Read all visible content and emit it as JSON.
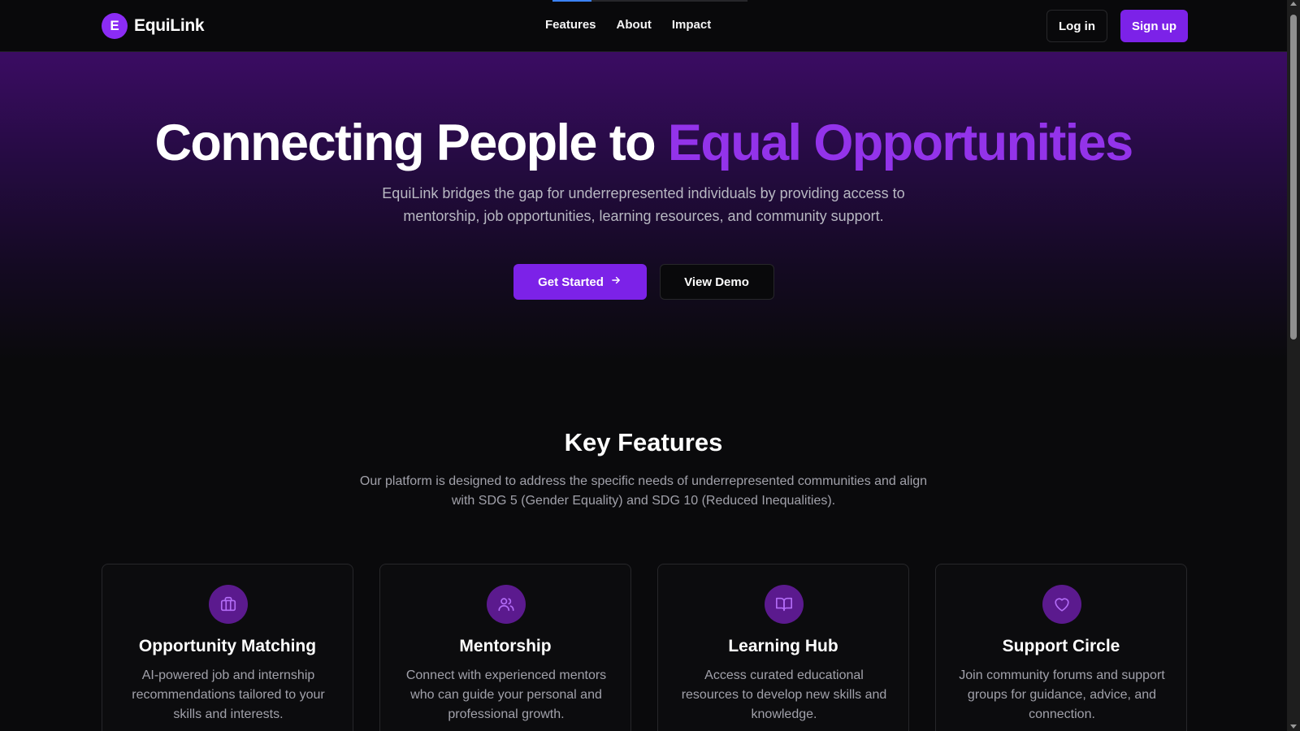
{
  "brand": {
    "mark": "E",
    "name": "EquiLink"
  },
  "nav": {
    "links": [
      "Features",
      "About",
      "Impact"
    ]
  },
  "auth": {
    "login_label": "Log in",
    "signup_label": "Sign up"
  },
  "hero": {
    "title_main": "Connecting People to ",
    "title_accent": "Equal Opportunities",
    "subtitle": "EquiLink bridges the gap for underrepresented individuals by providing access to mentorship, job opportunities, learning resources, and community support.",
    "primary_cta": "Get Started",
    "secondary_cta": "View Demo"
  },
  "features": {
    "title": "Key Features",
    "subtitle": "Our platform is designed to address the specific needs of underrepresented communities and align with SDG 5 (Gender Equality) and SDG 10 (Reduced Inequalities).",
    "cards": [
      {
        "icon": "briefcase-icon",
        "title": "Opportunity Matching",
        "description": "AI-powered job and internship recommendations tailored to your skills and interests."
      },
      {
        "icon": "users-icon",
        "title": "Mentorship",
        "description": "Connect with experienced mentors who can guide your personal and professional growth."
      },
      {
        "icon": "book-open-icon",
        "title": "Learning Hub",
        "description": "Access curated educational resources to develop new skills and knowledge."
      },
      {
        "icon": "heart-icon",
        "title": "Support Circle",
        "description": "Join community forums and support groups for guidance, advice, and connection."
      }
    ]
  },
  "colors": {
    "accent": "#7c22e8",
    "accent_text": "#9333ea",
    "background": "#09090b"
  },
  "scroll": {
    "progress_fraction": 0.2
  }
}
